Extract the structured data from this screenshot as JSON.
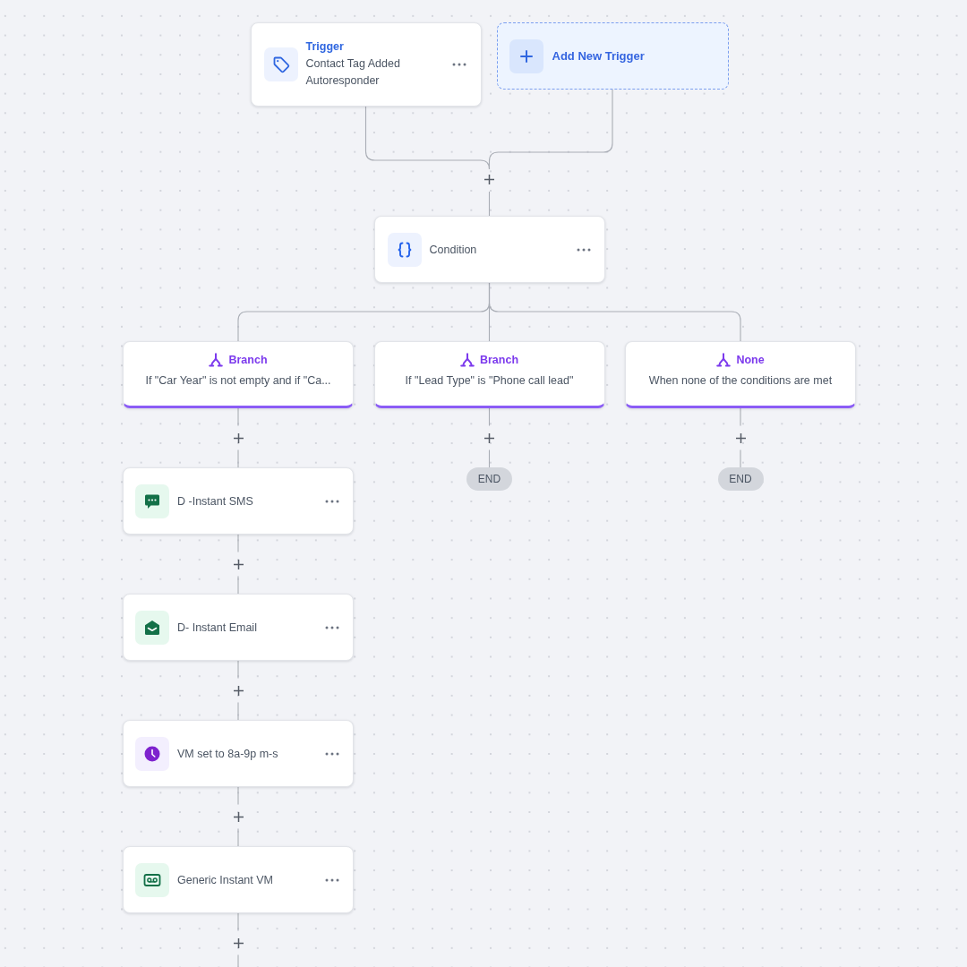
{
  "triggers": [
    {
      "title": "Trigger",
      "lines": [
        "Contact Tag Added",
        "Autoresponder"
      ]
    }
  ],
  "add_trigger": {
    "label": "Add New Trigger"
  },
  "condition": {
    "label": "Condition"
  },
  "branches": [
    {
      "title": "Branch",
      "description": "If \"Car Year\" is not empty and if \"Ca...",
      "steps": [
        {
          "kind": "sms",
          "label": "D -Instant SMS"
        },
        {
          "kind": "email",
          "label": "D- Instant Email"
        },
        {
          "kind": "wait",
          "label": "VM set to 8a-9p m-s"
        },
        {
          "kind": "voicemail",
          "label": "Generic Instant VM"
        }
      ]
    },
    {
      "title": "Branch",
      "description": "If \"Lead Type\" is \"Phone call lead\"",
      "end": {
        "label": "END"
      }
    },
    {
      "title": "None",
      "description": "When none of the conditions are met",
      "end": {
        "label": "END"
      }
    }
  ]
}
